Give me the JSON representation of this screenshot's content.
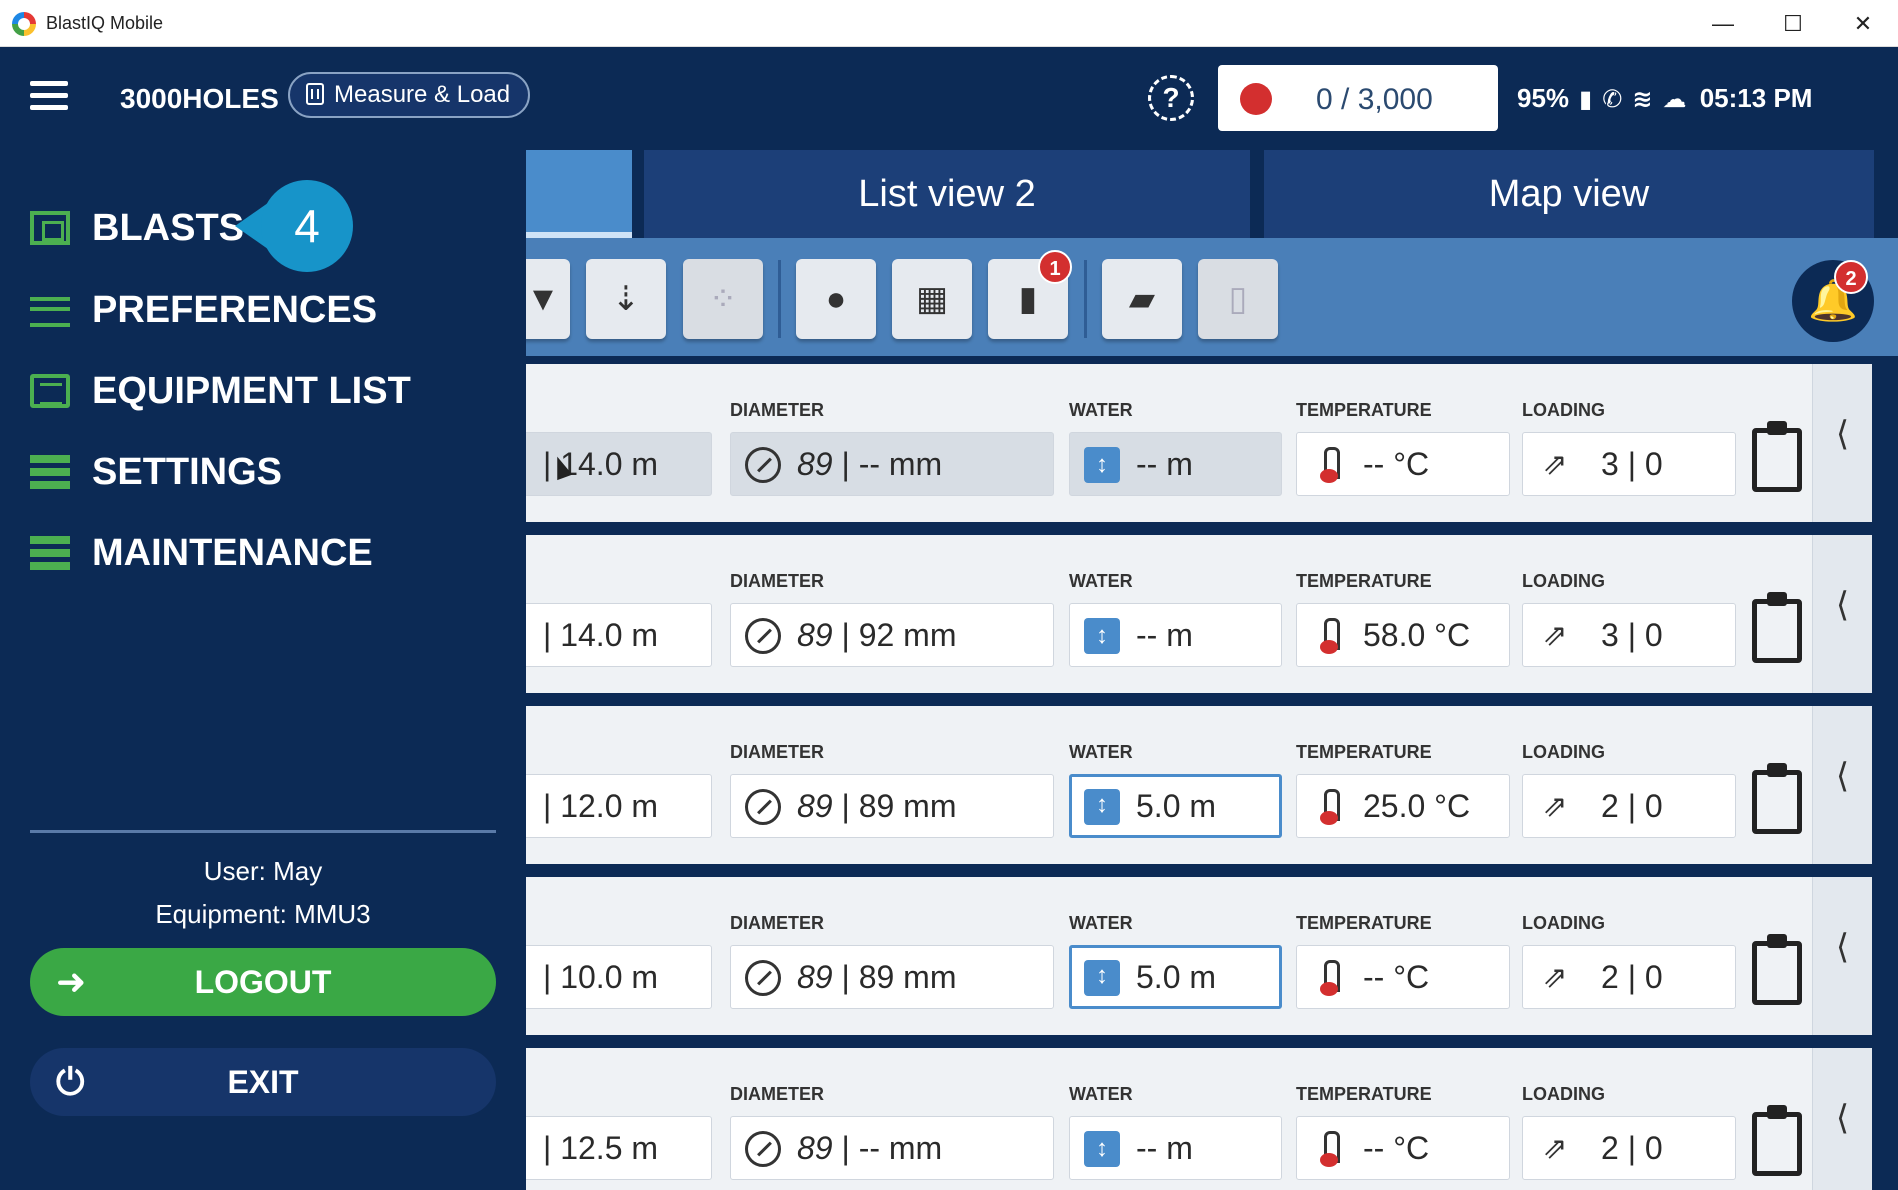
{
  "window": {
    "title": "BlastIQ Mobile",
    "min": "—",
    "max": "☐",
    "close": "✕"
  },
  "header": {
    "app_name": "3000HOLES",
    "mode_label": "Measure & Load",
    "counter": "0 / 3,000",
    "battery": "95%",
    "time": "05:13 PM"
  },
  "tabs": [
    {
      "label": ""
    },
    {
      "label": "List view 2"
    },
    {
      "label": "Map view"
    }
  ],
  "toolbar": {
    "clipboard_badge": "1",
    "notification_badge": "2"
  },
  "sidebar": {
    "items": [
      {
        "label": "BLASTS",
        "icon": "blast-icon"
      },
      {
        "label": "PREFERENCES",
        "icon": "sliders-icon"
      },
      {
        "label": "EQUIPMENT LIST",
        "icon": "list-icon"
      },
      {
        "label": "SETTINGS",
        "icon": "stack-icon"
      },
      {
        "label": "MAINTENANCE",
        "icon": "stack-icon"
      }
    ],
    "tooltip_number": "4",
    "user": "User: May",
    "equipment": "Equipment: MMU3",
    "logout_label": "LOGOUT",
    "exit_label": "EXIT"
  },
  "labels": {
    "diameter": "DIAMETER",
    "water": "WATER",
    "temperature": "TEMPERATURE",
    "loading": "LOADING"
  },
  "rows": [
    {
      "depth": "| 14.0  m",
      "diameter_design": "89",
      "diameter_rest": " | --  mm",
      "water": "-- m",
      "temperature": "-- °C",
      "loading": "3 | 0"
    },
    {
      "depth": "|  14.0  m",
      "diameter_design": "89",
      "diameter_rest": " | 92  mm",
      "water": "-- m",
      "temperature": "58.0 °C",
      "loading": "3 | 0"
    },
    {
      "depth": "|  12.0  m",
      "diameter_design": "89",
      "diameter_rest": " | 89  mm",
      "water": "5.0 m",
      "temperature": "25.0 °C",
      "loading": "2 | 0"
    },
    {
      "depth": "|  10.0  m",
      "diameter_design": "89",
      "diameter_rest": " | 89  mm",
      "water": "5.0 m",
      "temperature": "-- °C",
      "loading": "2 | 0"
    },
    {
      "depth": "|  12.5  m",
      "diameter_design": "89",
      "diameter_rest": " | --  mm",
      "water": "-- m",
      "temperature": "-- °C",
      "loading": "2 | 0"
    }
  ]
}
